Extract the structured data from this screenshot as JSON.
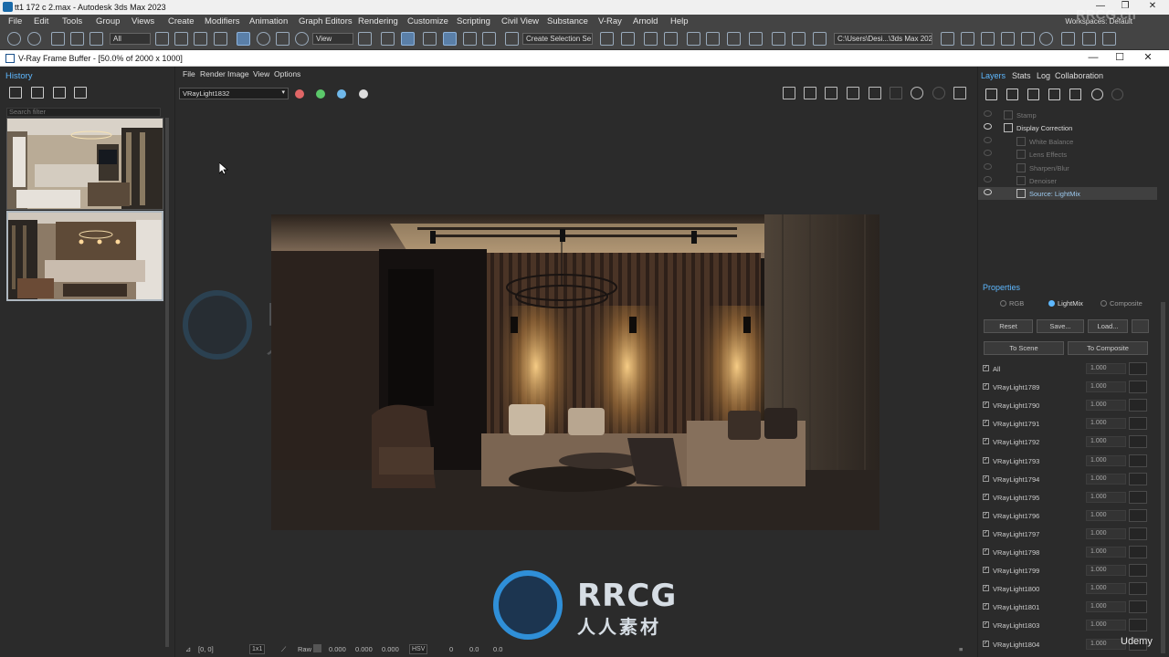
{
  "app": {
    "title": "tt1 172 c 2.max - Autodesk 3ds Max 2023",
    "window_controls": [
      "—",
      "❐",
      "✕"
    ]
  },
  "menu": [
    "File",
    "Edit",
    "Tools",
    "Group",
    "Views",
    "Create",
    "Modifiers",
    "Animation",
    "Graph Editors",
    "Rendering",
    "Customize",
    "Scripting",
    "Civil View",
    "Substance",
    "V-Ray",
    "Arnold",
    "Help"
  ],
  "workspaces": {
    "label": "Workspaces:",
    "value": "Default"
  },
  "toolbar": {
    "selection_filter": "All",
    "ref_coord": "View",
    "named_selection": "Create Selection Se",
    "project_path": "C:\\Users\\Desi...\\3ds Max 202"
  },
  "vfb": {
    "title": "V-Ray Frame Buffer - [50.0% of 2000 x 1000]",
    "window_controls": [
      "—",
      "☐",
      "✕"
    ],
    "menu": [
      "File",
      "Render",
      "Image",
      "View",
      "Options"
    ],
    "channel": "VRayLight1832",
    "color_dots": [
      "#e06666",
      "#5bc86a",
      "#6fb8ea"
    ]
  },
  "history": {
    "title": "History",
    "search_placeholder": "Search filter"
  },
  "status": {
    "coords": "[0, 0]",
    "zoom": "1x1",
    "mode": "Raw",
    "r": "0.000",
    "g": "0.000",
    "b": "0.000",
    "color_space": "HSV",
    "h": "0",
    "s": "0.0",
    "v": "0.0"
  },
  "right_panel": {
    "tabs": [
      "Layers",
      "Stats",
      "Log",
      "Collaboration"
    ],
    "layers": [
      {
        "label": "Stamp",
        "indent": 1,
        "active": false
      },
      {
        "label": "Display Correction",
        "indent": 1,
        "active": true
      },
      {
        "label": "White Balance",
        "indent": 2,
        "active": false
      },
      {
        "label": "Lens Effects",
        "indent": 2,
        "active": false
      },
      {
        "label": "Sharpen/Blur",
        "indent": 2,
        "active": false
      },
      {
        "label": "Denoiser",
        "indent": 2,
        "active": false
      },
      {
        "label": "Source: LightMix",
        "indent": 2,
        "active": true,
        "selected": true
      }
    ],
    "properties_title": "Properties",
    "modes": [
      "RGB",
      "LightMix",
      "Composite"
    ],
    "selected_mode": "LightMix",
    "buttons": {
      "reset": "Reset",
      "save": "Save...",
      "load": "Load...",
      "to_scene": "To Scene",
      "to_composite": "To Composite"
    },
    "lightmix": [
      {
        "name": "All",
        "value": "1.000"
      },
      {
        "name": "VRayLight1789",
        "value": "1.000"
      },
      {
        "name": "VRayLight1790",
        "value": "1.000"
      },
      {
        "name": "VRayLight1791",
        "value": "1.000"
      },
      {
        "name": "VRayLight1792",
        "value": "1.000"
      },
      {
        "name": "VRayLight1793",
        "value": "1.000"
      },
      {
        "name": "VRayLight1794",
        "value": "1.000"
      },
      {
        "name": "VRayLight1795",
        "value": "1.000"
      },
      {
        "name": "VRayLight1796",
        "value": "1.000"
      },
      {
        "name": "VRayLight1797",
        "value": "1.000"
      },
      {
        "name": "VRayLight1798",
        "value": "1.000"
      },
      {
        "name": "VRayLight1799",
        "value": "1.000"
      },
      {
        "name": "VRayLight1800",
        "value": "1.000"
      },
      {
        "name": "VRayLight1801",
        "value": "1.000"
      },
      {
        "name": "VRayLight1803",
        "value": "1.000"
      },
      {
        "name": "VRayLight1804",
        "value": "1.000"
      }
    ]
  },
  "watermarks": {
    "brand": "RRCG",
    "brand_cn": "人人素材",
    "top_right": "RRCG.cn",
    "udemy": "Udemy"
  }
}
